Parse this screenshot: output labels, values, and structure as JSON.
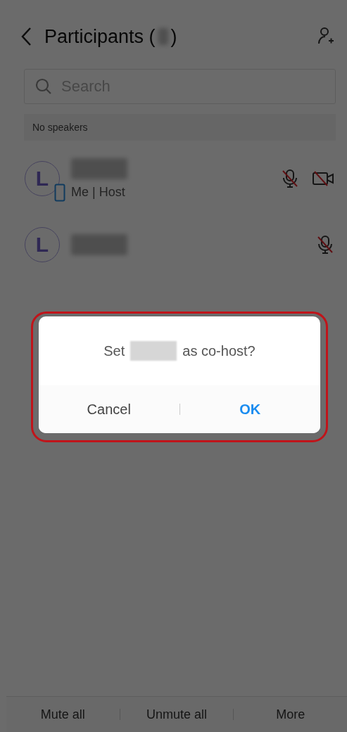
{
  "header": {
    "title_start": "Participants (",
    "title_end": ")"
  },
  "search": {
    "placeholder": "Search"
  },
  "speakers_bar": {
    "text": "No speakers"
  },
  "participants": [
    {
      "avatar": "L",
      "subtitle": "Me | Host",
      "on_phone": true,
      "mic_muted": true,
      "camera_off": true
    },
    {
      "avatar": "L",
      "on_phone": false,
      "mic_muted": true
    }
  ],
  "dialog": {
    "message_start": "Set",
    "message_end": "as co-host?",
    "buttons": [
      {
        "label": "Cancel",
        "kind": "cancel"
      },
      {
        "label": "OK",
        "kind": "confirm"
      }
    ],
    "highlighted": true
  },
  "bottom_bar": [
    "Mute all",
    "Unmute all",
    "More"
  ]
}
